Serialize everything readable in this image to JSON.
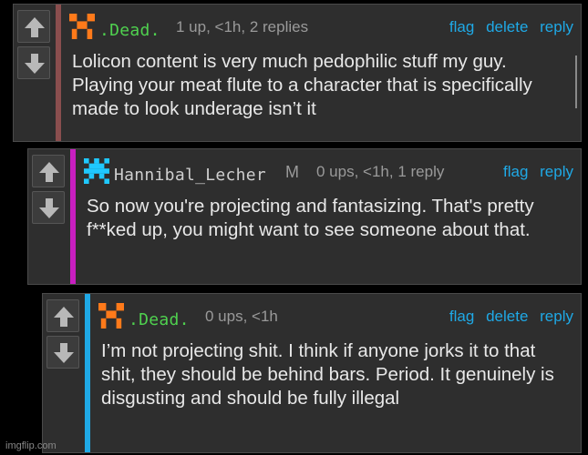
{
  "comments": [
    {
      "username": ".Dead.",
      "username_color": "#4fd14f",
      "meta": "1 up, <1h, 2 replies",
      "actions": [
        "flag",
        "delete",
        "reply"
      ],
      "bar_color": "#8a4e4e",
      "avatar_icon": "orange-pixel-avatar-icon",
      "text": "Lolicon content is very much pedophilic stuff my guy. Playing your meat flute to a character that is specifically made to look underage isn’t it"
    },
    {
      "username": "Hannibal_Lecher",
      "username_color": "#cfcfcf",
      "badge": "M",
      "meta": "0 ups, <1h, 1 reply",
      "actions": [
        "flag",
        "reply"
      ],
      "bar_color": "#c81fc0",
      "avatar_icon": "blue-pixel-avatar-icon",
      "text": "So now you're projecting and fantasizing. That's pretty f**ked up, you might want to see someone about that."
    },
    {
      "username": ".Dead.",
      "username_color": "#4fd14f",
      "meta": "0 ups, <1h",
      "actions": [
        "flag",
        "delete",
        "reply"
      ],
      "bar_color": "#1fa9e6",
      "avatar_icon": "orange-pixel-avatar-icon",
      "text": "I’m not projecting shit. I think if anyone jorks it to that shit, they should be behind bars. Period. It genuinely is disgusting and should be fully illegal"
    }
  ],
  "watermark": "imgflip.com"
}
